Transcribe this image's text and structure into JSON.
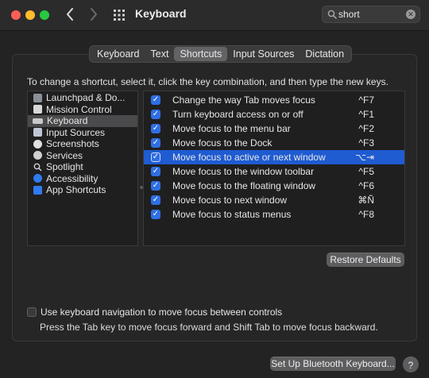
{
  "window": {
    "title": "Keyboard"
  },
  "search": {
    "value": "short",
    "clear_glyph": "✕"
  },
  "tabs": [
    {
      "label": "Keyboard",
      "selected": false
    },
    {
      "label": "Text",
      "selected": false
    },
    {
      "label": "Shortcuts",
      "selected": true
    },
    {
      "label": "Input Sources",
      "selected": false
    },
    {
      "label": "Dictation",
      "selected": false
    }
  ],
  "instruction": "To change a shortcut, select it, click the key combination, and then type the new keys.",
  "categories": [
    {
      "label": "Launchpad & Do...",
      "icon": "launchpad-icon",
      "color": "#8a8f98"
    },
    {
      "label": "Mission Control",
      "icon": "mission-control-icon",
      "color": "#d8d8d8"
    },
    {
      "label": "Keyboard",
      "icon": "keyboard-icon",
      "color": "#c9c9c9",
      "selected": true
    },
    {
      "label": "Input Sources",
      "icon": "input-sources-icon",
      "color": "#bfc6d4"
    },
    {
      "label": "Screenshots",
      "icon": "screenshots-icon",
      "color": "#e0e0e0"
    },
    {
      "label": "Services",
      "icon": "services-gear-icon",
      "color": "#cfcfcf"
    },
    {
      "label": "Spotlight",
      "icon": "spotlight-icon",
      "color": "#cfcfcf"
    },
    {
      "label": "Accessibility",
      "icon": "accessibility-icon",
      "color": "#2f7bf0"
    },
    {
      "label": "App Shortcuts",
      "icon": "app-shortcuts-icon",
      "color": "#2f7bf0"
    }
  ],
  "shortcuts": [
    {
      "label": "Change the way Tab moves focus",
      "key": "^F7",
      "checked": true
    },
    {
      "label": "Turn keyboard access on or off",
      "key": "^F1",
      "checked": true
    },
    {
      "label": "Move focus to the menu bar",
      "key": "^F2",
      "checked": true
    },
    {
      "label": "Move focus to the Dock",
      "key": "^F3",
      "checked": true
    },
    {
      "label": "Move focus to active or next window",
      "key": "⌥⇥",
      "checked": true,
      "selected": true
    },
    {
      "label": "Move focus to the window toolbar",
      "key": "^F5",
      "checked": true
    },
    {
      "label": "Move focus to the floating window",
      "key": "^F6",
      "checked": true
    },
    {
      "label": "Move focus to next window",
      "key": "⌘Ñ",
      "checked": true
    },
    {
      "label": "Move focus to status menus",
      "key": "^F8",
      "checked": true
    }
  ],
  "checkmark": "✓",
  "restore_defaults": "Restore Defaults",
  "keyboard_navigation": {
    "label": "Use keyboard navigation to move focus between controls",
    "checked": false,
    "help": "Press the Tab key to move focus forward and Shift Tab to move focus backward."
  },
  "bluetooth_button": "Set Up Bluetooth Keyboard...",
  "help_button": "?",
  "colors": {
    "accent": "#1f5bd1",
    "close": "#fe5f57",
    "minimize": "#febc2e",
    "maximize": "#28c840"
  }
}
